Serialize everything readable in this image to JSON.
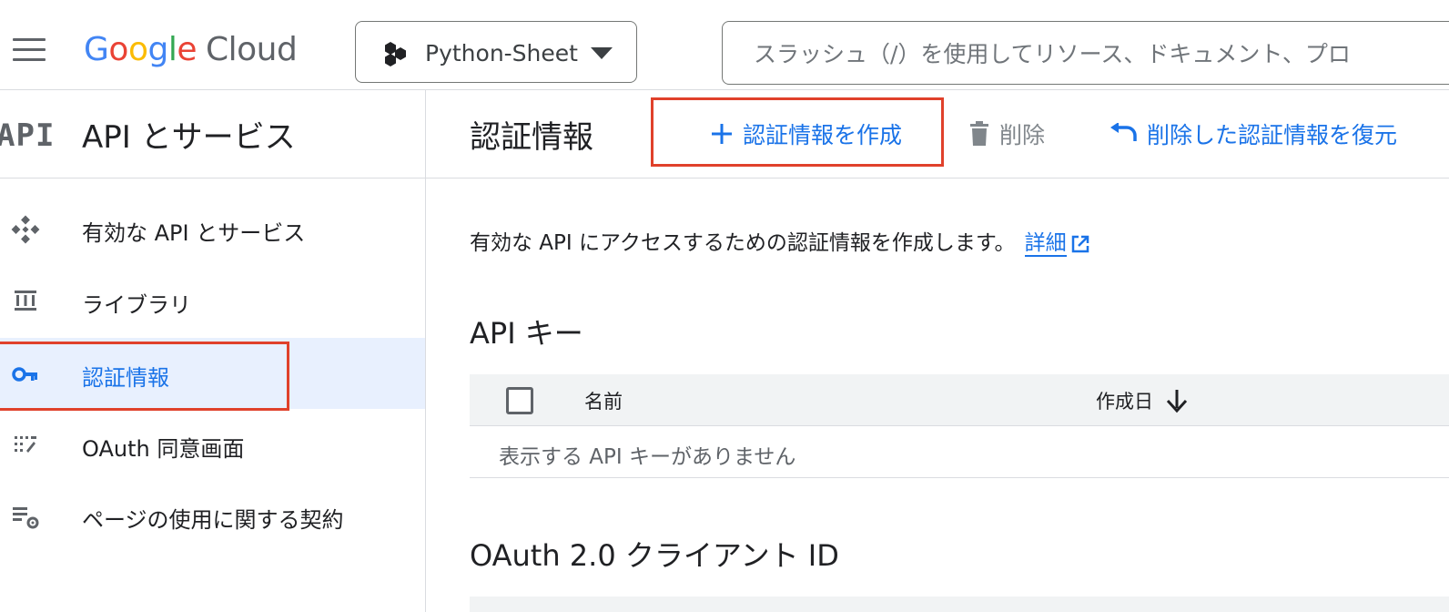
{
  "header": {
    "logo_google": "Google",
    "logo_cloud": "Cloud",
    "project_name": "Python-Sheet",
    "search_placeholder": "スラッシュ（/）を使用してリソース、ドキュメント、プロ"
  },
  "sidebar": {
    "api_mark": "API",
    "title": "API とサービス",
    "items": [
      {
        "label": "有効な API とサービス",
        "icon": "api-diamond-icon"
      },
      {
        "label": "ライブラリ",
        "icon": "library-icon"
      },
      {
        "label": "認証情報",
        "icon": "key-icon",
        "active": true
      },
      {
        "label": "OAuth 同意画面",
        "icon": "consent-icon"
      },
      {
        "label": "ページの使用に関する契約",
        "icon": "agreement-icon"
      }
    ]
  },
  "main": {
    "title": "認証情報",
    "toolbar": {
      "create_label": "認証情報を作成",
      "delete_label": "削除",
      "restore_label": "削除した認証情報を復元"
    },
    "description": "有効な API にアクセスするための認証情報を作成します。",
    "description_link": "詳細",
    "api_keys": {
      "title": "API キー",
      "columns": [
        "名前",
        "作成日"
      ],
      "empty_message": "表示する API キーがありません"
    },
    "oauth": {
      "title": "OAuth 2.0 クライアント ID"
    }
  },
  "colors": {
    "accent": "#1a73e8",
    "highlight": "#e0412b",
    "active_bg": "#e8f0fe"
  }
}
